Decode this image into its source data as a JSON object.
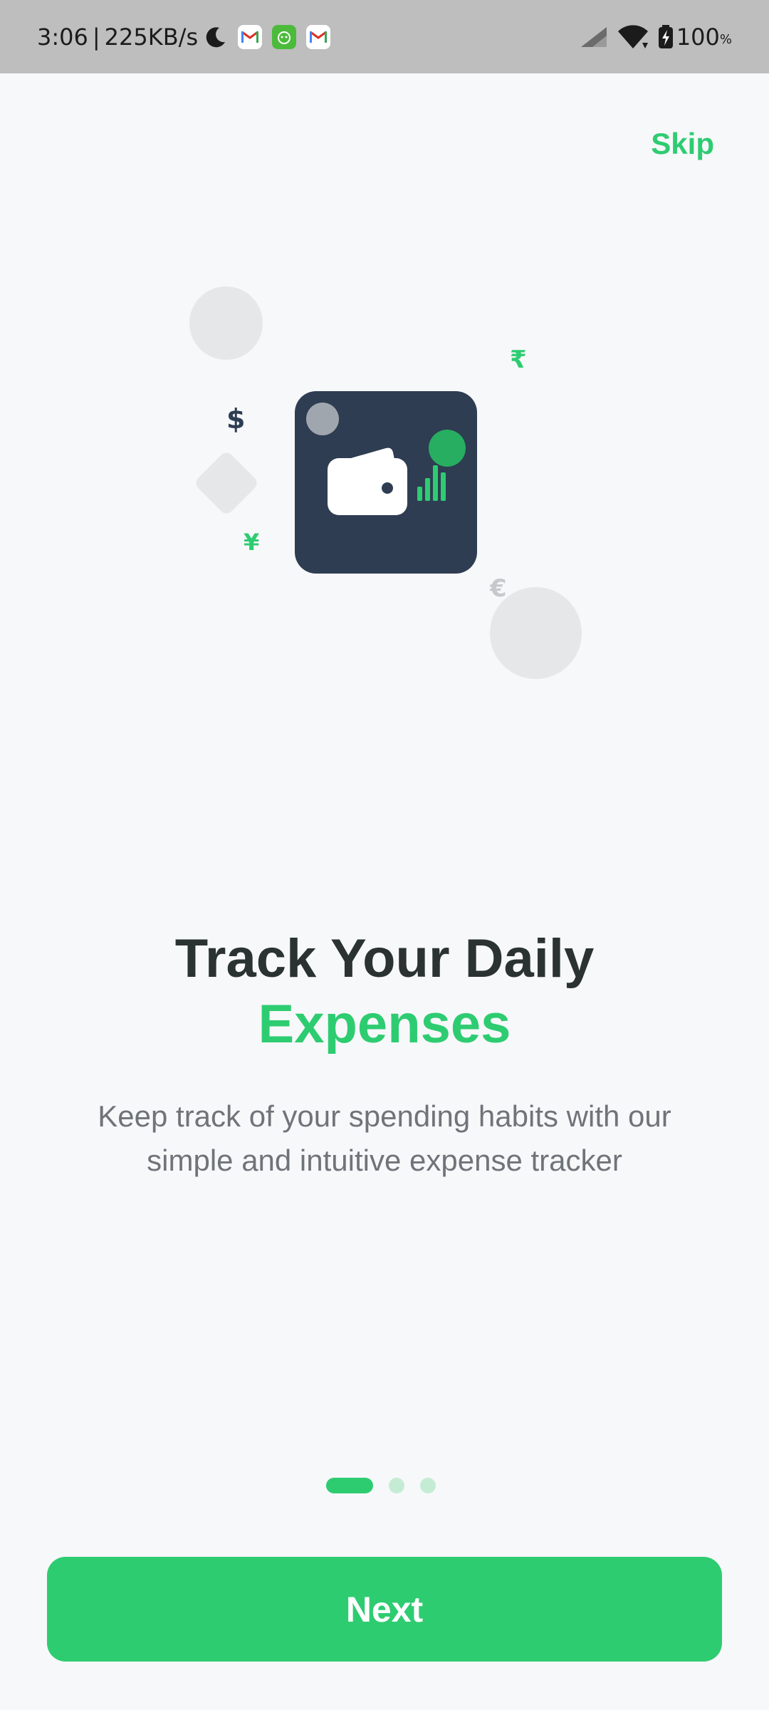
{
  "status_bar": {
    "time": "3:06",
    "separator": "|",
    "speed": "225KB/s",
    "battery": "100",
    "battery_unit": "%",
    "icons": [
      "moon-icon",
      "gmail-icon",
      "android-app-icon",
      "gmail-icon",
      "signal-icon",
      "wifi-icon",
      "battery-charging-icon"
    ]
  },
  "header": {
    "skip_label": "Skip"
  },
  "illustration": {
    "currencies": {
      "dollar": "$",
      "rupee": "₹",
      "yen": "¥",
      "euro": "€"
    },
    "main_icon": "wallet-icon",
    "chart_icon": "bar-chart-icon"
  },
  "onboarding": {
    "title_line1": "Track Your Daily",
    "title_line2": "Expenses",
    "subtitle": "Keep track of your spending habits with our simple and intuitive expense tracker",
    "current_page": 1,
    "page_count": 3
  },
  "footer": {
    "next_label": "Next"
  },
  "colors": {
    "accent": "#2ecc71",
    "card": "#2e3d52",
    "background": "#f7f8fa",
    "title": "#2b3332",
    "subtitle": "#6f7479"
  }
}
